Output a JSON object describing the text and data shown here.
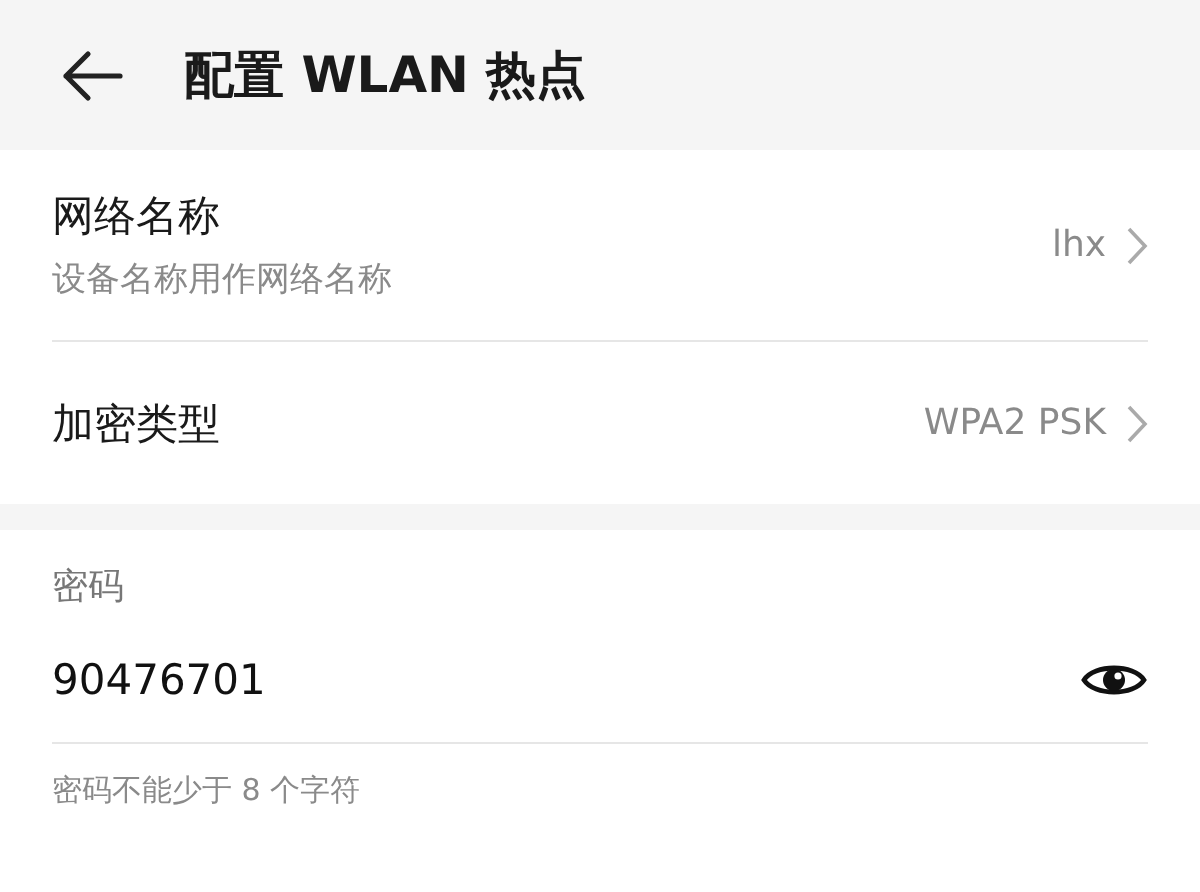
{
  "header": {
    "title": "配置 WLAN 热点"
  },
  "settings": [
    {
      "title": "网络名称",
      "subtitle": "设备名称用作网络名称",
      "value": "lhx"
    },
    {
      "title": "加密类型",
      "value": "WPA2 PSK"
    }
  ],
  "password": {
    "label": "密码",
    "value": "90476701",
    "hint": "密码不能少于 8 个字符"
  }
}
